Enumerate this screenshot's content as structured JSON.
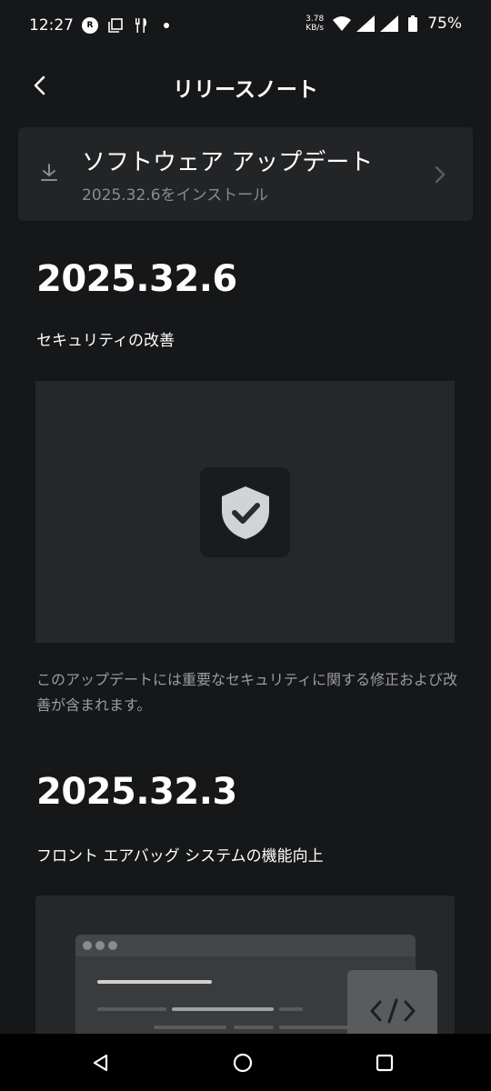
{
  "status_bar": {
    "time": "12:27",
    "net_speed_value": "3.78",
    "net_speed_unit": "KB/s",
    "battery": "75%"
  },
  "header": {
    "title": "リリースノート"
  },
  "update_card": {
    "title": "ソフトウェア アップデート",
    "subtitle": "2025.32.6をインストール"
  },
  "releases": [
    {
      "version": "2025.32.6",
      "title": "セキュリティの改善",
      "image_icon": "shield-check-icon",
      "description": "このアップデートには重要なセキュリティに関する修正および改善が含まれます。"
    },
    {
      "version": "2025.32.3",
      "title": "フロント エアバッグ システムの機能向上",
      "image_icon": "code-window-icon"
    }
  ],
  "nav_bar": {
    "icons": [
      "back-triangle-icon",
      "home-circle-icon",
      "recents-square-icon"
    ]
  },
  "colors": {
    "background": "#161719",
    "card": "#232426",
    "media_box": "#262729",
    "muted_text": "#9a9b9d"
  }
}
